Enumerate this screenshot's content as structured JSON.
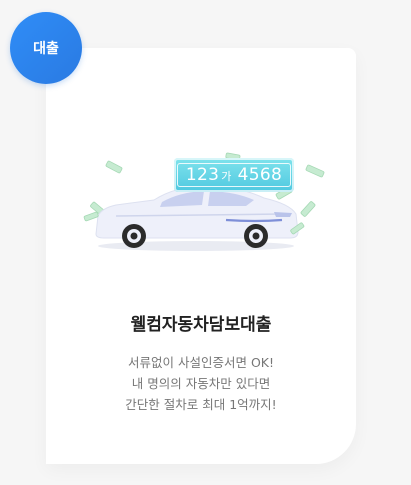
{
  "badge": {
    "label": "대출"
  },
  "plate": {
    "number_left": "123",
    "number_hangul": "가",
    "number_right": "4568"
  },
  "card": {
    "title": "웰컴자동차담보대출",
    "description": [
      "서류없이 사설인증서면 OK!",
      "내 명의의 자동차만 있다면",
      "간단한 절차로 최대 1억까지!"
    ]
  },
  "colors": {
    "badge": "#2a86f0",
    "plate": "#5fd2e6",
    "car_body": "#f1f3fb",
    "money": "#bfe6c9",
    "title": "#222222",
    "text": "#777777"
  },
  "icons": {
    "illustration": "car-with-plate-and-money-icon"
  }
}
